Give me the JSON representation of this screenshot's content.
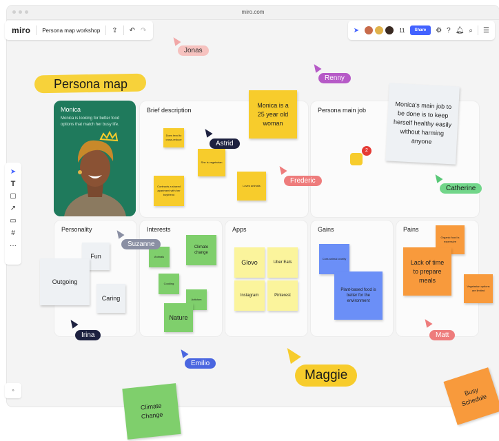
{
  "window": {
    "url": "miro.com"
  },
  "toolbar": {
    "logo": "miro",
    "board_name": "Persona map workshop",
    "collaborator_count": "11",
    "share_label": "Share"
  },
  "board": {
    "title": "Persona map",
    "monica": {
      "title": "Monica",
      "subtitle": "Monica is looking for better food options that match her busy life."
    },
    "brief_description": {
      "title": "Brief description",
      "notes": [
        "Does tend to cross-reduce",
        "She is vegetarian",
        "Contracts a shared apartment with her boyfriend",
        "Loves animals"
      ],
      "big_note": "Monica is a 25 year old woman"
    },
    "persona_main_job": {
      "title": "Persona main job",
      "note": "Monica's main job to be done is to keep herself healthy easily without harming anyone",
      "badge_count": "2"
    },
    "personality": {
      "title": "Personality",
      "notes": [
        "Fun",
        "Outgoing",
        "Caring"
      ]
    },
    "interests": {
      "title": "Interests",
      "notes": [
        "Animals",
        "Climate change",
        "Cooking",
        "Nature",
        "Activism"
      ]
    },
    "apps": {
      "title": "Apps",
      "notes": [
        "Glovo",
        "Uber Eats",
        "Instagram",
        "Pinterest"
      ]
    },
    "gains": {
      "title": "Gains",
      "notes": [
        "Cora animal cruelty",
        "Plant-based food is better for the environment"
      ]
    },
    "pains": {
      "title": "Pains",
      "notes": [
        "Organic food is expensive",
        "Lack of time to prepare meals",
        "Vegetarian options are limited"
      ]
    }
  },
  "cursors": {
    "jonas": "Jonas",
    "renny": "Renny",
    "astrid": "Astrid",
    "frederic": "Frederic",
    "catherine": "Catherine",
    "suzanne": "Suzanne",
    "irina": "Irina",
    "emilio": "Emilio",
    "maggie": "Maggie",
    "matt": "Matt"
  },
  "floating_notes": {
    "climate_change": "Climate Change",
    "busy_schedule": "Busy Schedule"
  },
  "colors": {
    "miro_blue": "#4262ff",
    "yellow": "#f7cc2c",
    "green": "#7fcf6c",
    "blue": "#6b8ff7",
    "orange": "#f89a3c",
    "monica_green": "#1f7a5c"
  }
}
